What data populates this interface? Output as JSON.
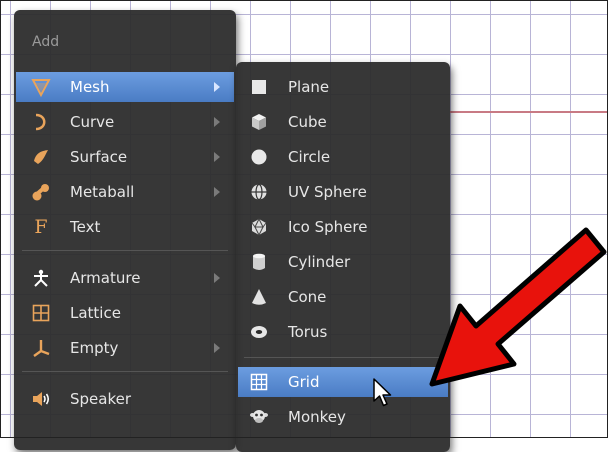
{
  "add_menu": {
    "title": "Add",
    "items": [
      {
        "label": "Mesh",
        "icon": "mesh-triangle-icon",
        "submenu": true,
        "selected": true
      },
      {
        "label": "Curve",
        "icon": "curve-icon",
        "submenu": true
      },
      {
        "label": "Surface",
        "icon": "surface-icon",
        "submenu": true
      },
      {
        "label": "Metaball",
        "icon": "metaball-icon",
        "submenu": true
      },
      {
        "label": "Text",
        "icon": "text-f-icon",
        "submenu": false
      },
      {
        "label": "Armature",
        "icon": "armature-icon",
        "submenu": true
      },
      {
        "label": "Lattice",
        "icon": "lattice-icon",
        "submenu": false
      },
      {
        "label": "Empty",
        "icon": "empty-axes-icon",
        "submenu": true
      },
      {
        "label": "Speaker",
        "icon": "speaker-icon",
        "submenu": false
      }
    ]
  },
  "mesh_menu": {
    "items": [
      {
        "label": "Plane",
        "icon": "plane-icon"
      },
      {
        "label": "Cube",
        "icon": "cube-icon"
      },
      {
        "label": "Circle",
        "icon": "circle-icon"
      },
      {
        "label": "UV Sphere",
        "icon": "uv-sphere-icon"
      },
      {
        "label": "Ico Sphere",
        "icon": "ico-sphere-icon"
      },
      {
        "label": "Cylinder",
        "icon": "cylinder-icon"
      },
      {
        "label": "Cone",
        "icon": "cone-icon"
      },
      {
        "label": "Torus",
        "icon": "torus-icon"
      },
      {
        "label": "Grid",
        "icon": "grid-icon",
        "selected": true
      },
      {
        "label": "Monkey",
        "icon": "monkey-icon"
      }
    ]
  },
  "colors": {
    "menu_bg": "#2a2a2a",
    "selection": "#5680c2",
    "annotation_arrow": "#e8120c",
    "viewport_grid": "#b8b4d6",
    "x_axis_line": "#c87a84"
  }
}
